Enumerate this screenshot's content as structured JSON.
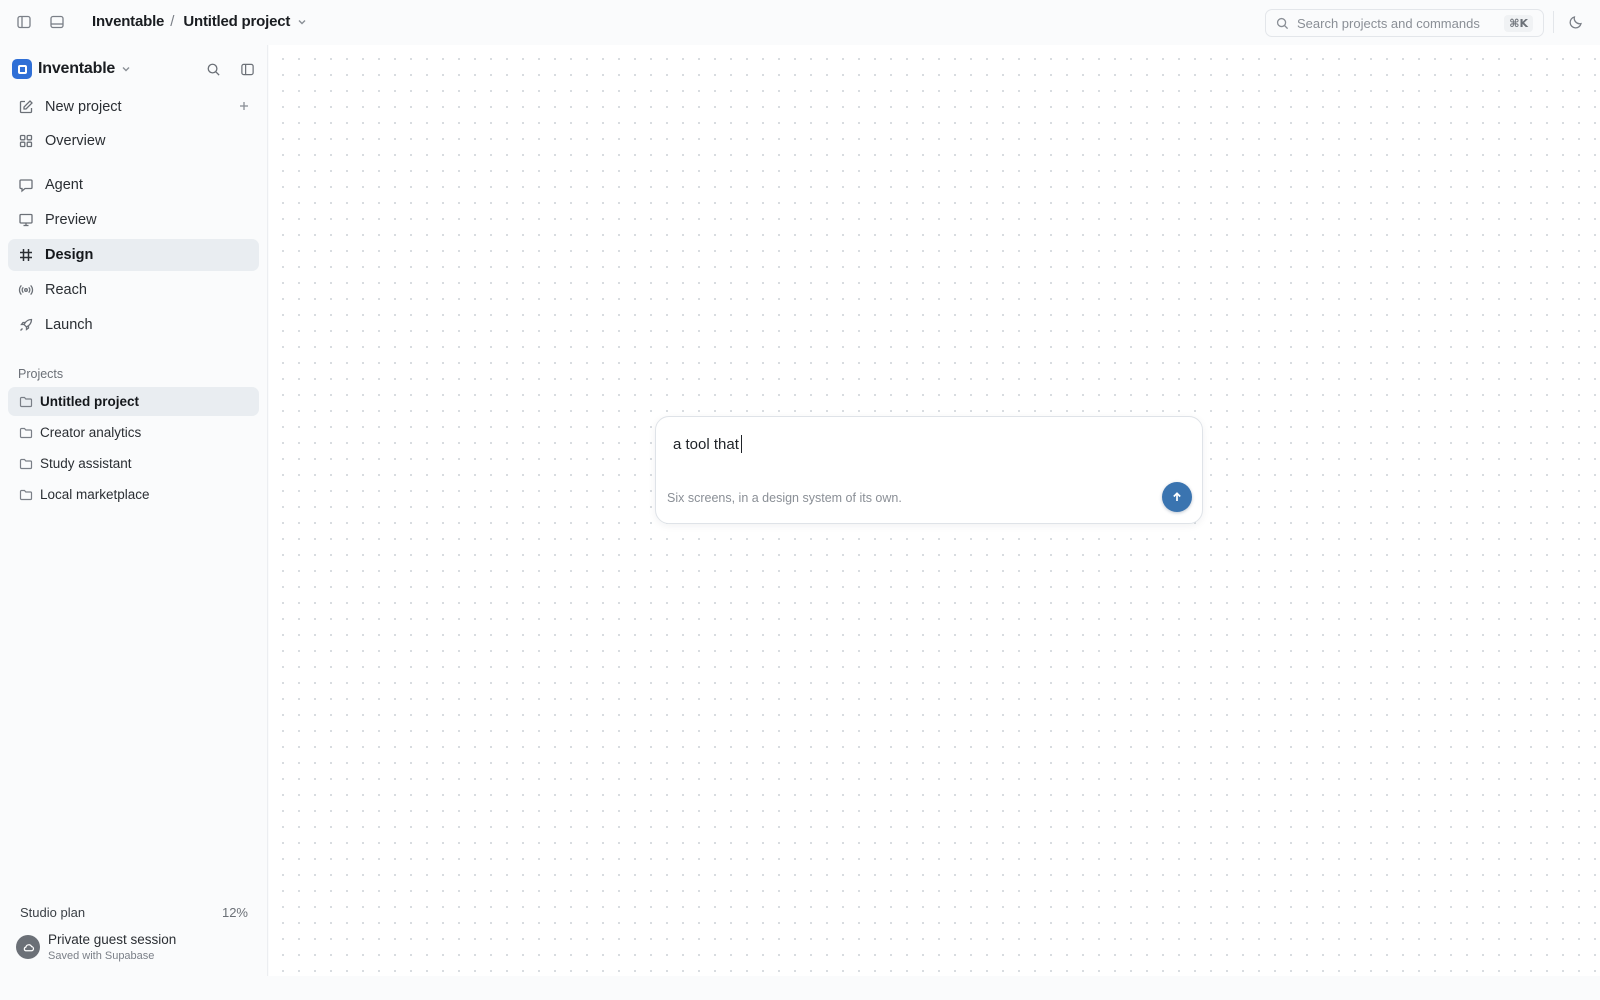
{
  "topbar": {
    "app_name": "Inventable",
    "separator": "/",
    "project_name": "Untitled project",
    "search_placeholder": "Search projects and commands",
    "search_shortcut": "⌘K"
  },
  "sidebar": {
    "brand": "Inventable",
    "nav": [
      {
        "label": "New project",
        "icon": "new-project-icon"
      },
      {
        "label": "Overview",
        "icon": "grid-icon"
      },
      {
        "label": "Agent",
        "icon": "chat-icon"
      },
      {
        "label": "Preview",
        "icon": "monitor-icon"
      },
      {
        "label": "Design",
        "icon": "hash-icon",
        "active": true
      },
      {
        "label": "Reach",
        "icon": "broadcast-icon"
      },
      {
        "label": "Launch",
        "icon": "rocket-icon"
      }
    ],
    "projects_label": "Projects",
    "projects": [
      {
        "label": "Untitled project",
        "active": true
      },
      {
        "label": "Creator analytics"
      },
      {
        "label": "Study assistant"
      },
      {
        "label": "Local marketplace"
      }
    ],
    "plan": {
      "label": "Studio plan",
      "usage": "12%"
    },
    "session": {
      "title": "Private guest session",
      "subtitle": "Saved with Supabase"
    }
  },
  "prompt": {
    "value": "a tool that",
    "hint": "Six screens, in a design system of its own."
  },
  "colors": {
    "accent": "#3a74b0",
    "brand": "#2f6fd6",
    "active_bg": "#e9edf1"
  }
}
